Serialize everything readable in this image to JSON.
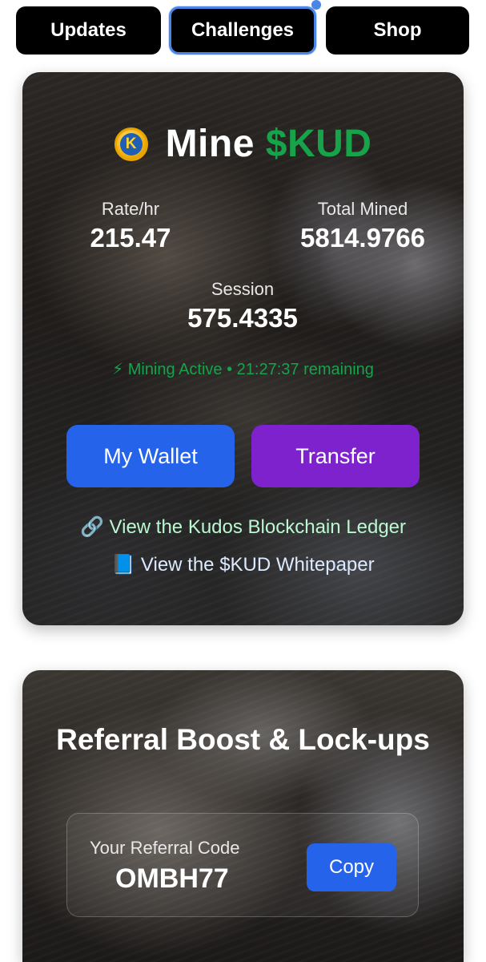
{
  "tabs": [
    {
      "label": "Updates"
    },
    {
      "label": "Challenges"
    },
    {
      "label": "Shop"
    }
  ],
  "mine_card": {
    "title_prefix": "Mine",
    "title_accent": "$KUD",
    "coin_letter": "K",
    "rate_label": "Rate/hr",
    "rate_value": "215.47",
    "total_label": "Total Mined",
    "total_value": "5814.9766",
    "session_label": "Session",
    "session_value": "575.4335",
    "status_text": "⚡ Mining Active • 21:27:37 remaining",
    "wallet_label": "My Wallet",
    "transfer_label": "Transfer",
    "ledger_link": "🔗 View the Kudos Blockchain Ledger",
    "whitepaper_link": "📘 View the $KUD Whitepaper"
  },
  "referral_card": {
    "title": "Referral Boost & Lock-ups",
    "code_label": "Your Referral Code",
    "code_value": "OMBH77",
    "copy_label": "Copy"
  },
  "colors": {
    "accent_green": "#16a34a",
    "wallet_blue": "#2563eb",
    "transfer_purple": "#7e22ce",
    "tab_focus": "#4a86e8"
  }
}
